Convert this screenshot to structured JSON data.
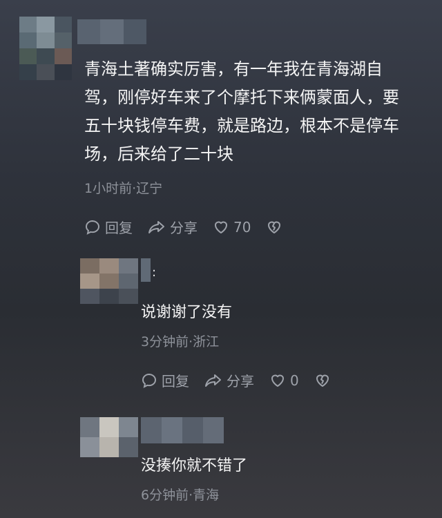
{
  "comment": {
    "text_lines": [
      "青海土著确实厉害，有一年我在青海湖自",
      "驾，刚停好车来了个摩托下来俩蒙面人，要",
      "五十块钱停车费，就是路边，根本不是停车",
      "场，后来给了二十块"
    ],
    "meta": "1小时前·辽宁",
    "reply_label": "回复",
    "share_label": "分享",
    "like_count": "70"
  },
  "replies": [
    {
      "text": "说谢谢了没有",
      "meta": "3分钟前·浙江",
      "reply_label": "回复",
      "share_label": "分享",
      "like_count": "0"
    },
    {
      "text": "没揍你就不错了",
      "meta": "6分钟前·青海"
    }
  ],
  "icons": [
    "comment-bubble-icon",
    "share-arrow-icon",
    "heart-icon",
    "broken-heart-icon"
  ],
  "colors": {
    "text": "#f4f4f4",
    "meta": "#8e929a",
    "actions": "#9ea2aa"
  }
}
